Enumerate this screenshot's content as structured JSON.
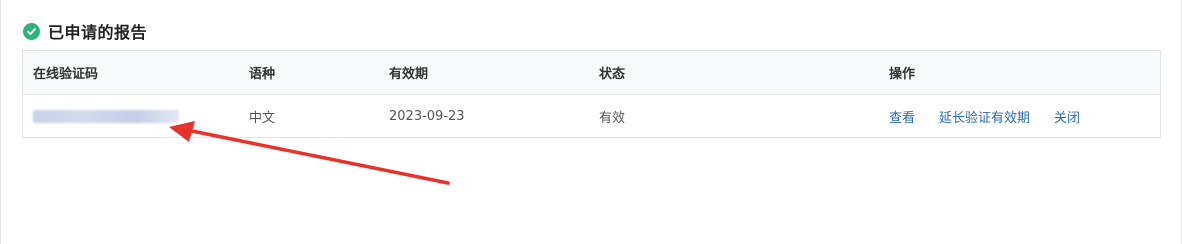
{
  "section": {
    "title": "已申请的报告",
    "icon": "check-circle-icon",
    "icon_color": "#2db580"
  },
  "table": {
    "headers": [
      "在线验证码",
      "语种",
      "有效期",
      "状态",
      "操作"
    ],
    "rows": [
      {
        "code": "",
        "language": "中文",
        "valid_until": "2023-09-23",
        "status": "有效",
        "actions": [
          "查看",
          "延长验证有效期",
          "关闭"
        ]
      }
    ]
  },
  "colors": {
    "link": "#2b6cb0",
    "annotation": "#e8312a",
    "header_bg": "#f7f9fa"
  }
}
